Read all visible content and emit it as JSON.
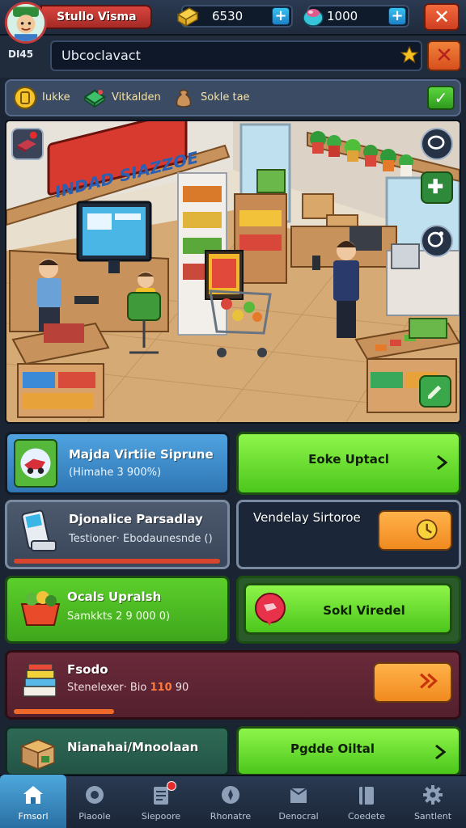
{
  "player": {
    "name": "Stullo Visma",
    "level_label": "DI45"
  },
  "resources": {
    "gold": "6530",
    "gems": "1000"
  },
  "search": {
    "value": "Ubcoclavact"
  },
  "tabs": [
    {
      "label": "Iukke",
      "icon": "coin-icon"
    },
    {
      "label": "Vitkalden",
      "icon": "cash-icon"
    },
    {
      "label": "Sokle tae",
      "icon": "sack-icon"
    }
  ],
  "scene": {
    "sign_text": "INDAD SIAZZOE"
  },
  "cards": {
    "c1": {
      "title": "Majda Virtiie Siprune",
      "sub": "(Himahe 3 900%)"
    },
    "c1_button": {
      "label": "Eoke Uptacl"
    },
    "c2": {
      "title": "Djonalice Parsadlay",
      "sub": "Testioner· Ebodaunesnde ()",
      "progress": 0.93
    },
    "c2_side": {
      "title": "Vendelay Sirtoroe"
    },
    "c3": {
      "title": "Ocals Upralsh",
      "sub": "Samkkts 2 9 000 0)"
    },
    "c3_button": {
      "label": "Sokl Viredel"
    },
    "c4": {
      "title": "Fsodo",
      "sub_prefix": "Stenelexer· Bio",
      "sub_highlight": "110",
      "sub_suffix": "90",
      "progress": 0.28
    },
    "c5": {
      "title": "Nianahai/Mnoolaan"
    },
    "c5_button": {
      "label": "Pgdde Oiltal"
    }
  },
  "nav": [
    {
      "label": "Fmsorl",
      "icon": "home-icon",
      "active": true
    },
    {
      "label": "Piaoole",
      "icon": "gear-icon"
    },
    {
      "label": "Siepoore",
      "icon": "clipboard-icon",
      "badge": true
    },
    {
      "label": "Rhonatre",
      "icon": "compass-icon"
    },
    {
      "label": "Denocral",
      "icon": "box-icon"
    },
    {
      "label": "Coedete",
      "icon": "book-icon"
    },
    {
      "label": "Santlent",
      "icon": "cog-icon"
    }
  ],
  "colors": {
    "accent_green": "#5ccf2b",
    "accent_orange": "#f29a2c",
    "accent_red": "#d9453e",
    "panel_blue": "#3c5f82"
  }
}
